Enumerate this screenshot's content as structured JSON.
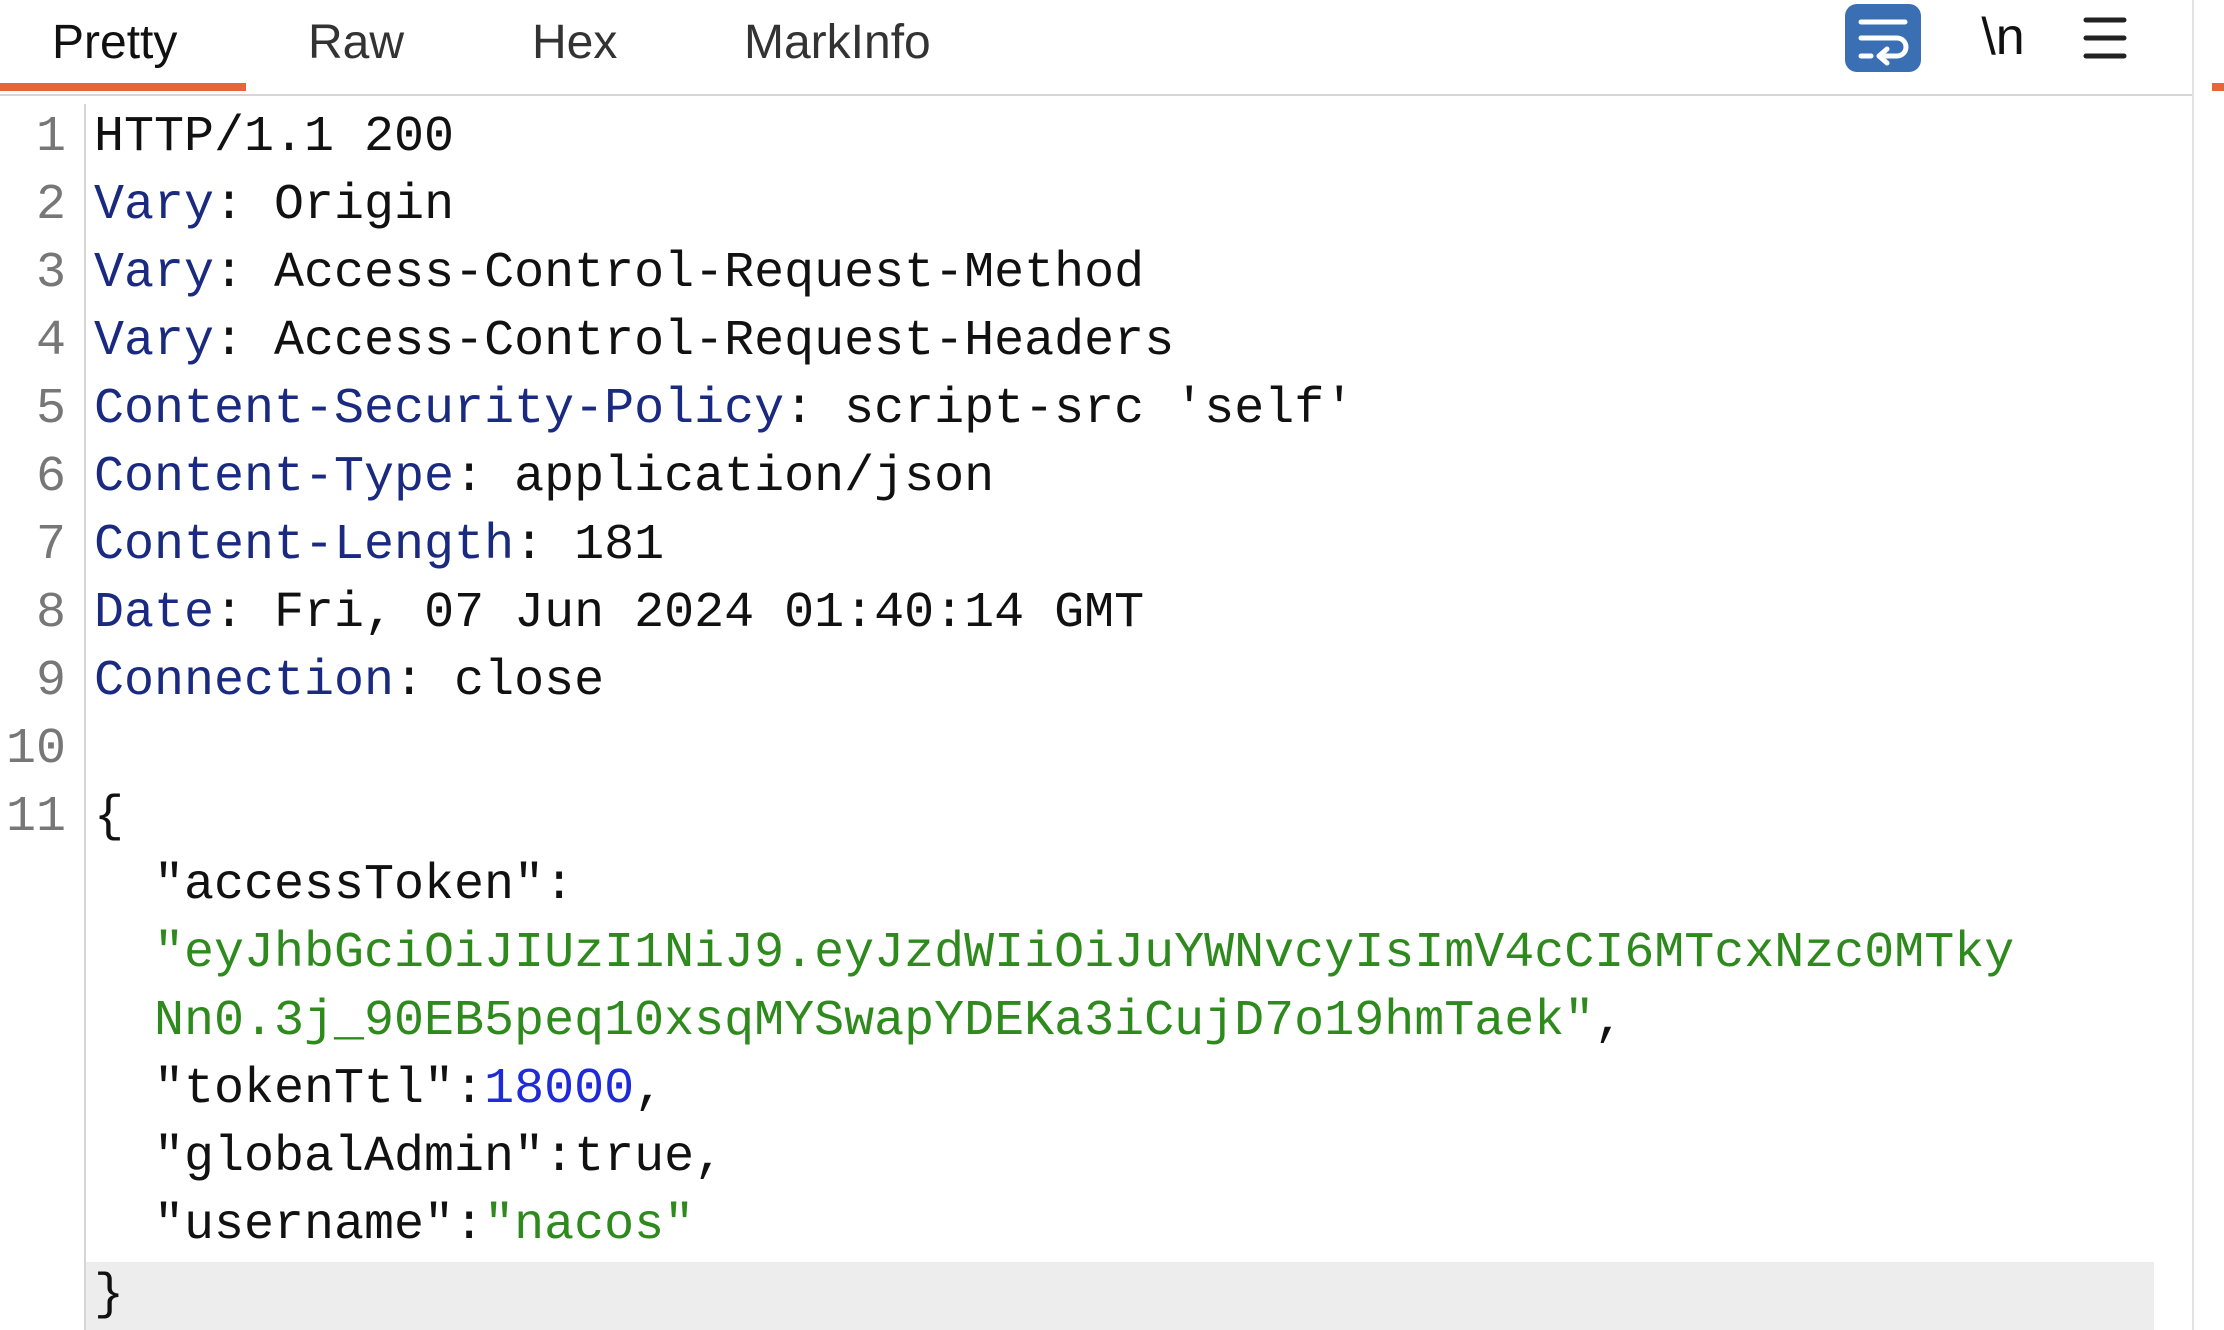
{
  "tabs": [
    {
      "label": "Pretty",
      "active": true
    },
    {
      "label": "Raw",
      "active": false
    },
    {
      "label": "Hex",
      "active": false
    },
    {
      "label": "MarkInfo",
      "active": false
    }
  ],
  "toolbar": {
    "wrap_icon": "word-wrap-icon",
    "newline_label": "\\n",
    "menu_icon": "hamburger-menu-icon"
  },
  "colors": {
    "accent": "#e8653a",
    "wrap_button": "#3a6fb4",
    "header_name": "#1a2a80",
    "string": "#2f8a1e",
    "number": "#1f2ad8"
  },
  "line_numbers": [
    "1",
    "2",
    "3",
    "4",
    "5",
    "6",
    "7",
    "8",
    "9",
    "10",
    "11"
  ],
  "response": {
    "status_line": "HTTP/1.1 200",
    "separator": ": ",
    "headers": [
      {
        "name": "Vary",
        "value": "Origin"
      },
      {
        "name": "Vary",
        "value": "Access-Control-Request-Method"
      },
      {
        "name": "Vary",
        "value": "Access-Control-Request-Headers"
      },
      {
        "name": "Content-Security-Policy",
        "value": "script-src 'self'"
      },
      {
        "name": "Content-Type",
        "value": "application/json"
      },
      {
        "name": "Content-Length",
        "value": "181"
      },
      {
        "name": "Date",
        "value": "Fri, 07 Jun 2024 01:40:14 GMT"
      },
      {
        "name": "Connection",
        "value": "close"
      }
    ],
    "body": {
      "open_brace": "{",
      "close_brace": "}",
      "colon": ":",
      "comma": ",",
      "access_token_key": "\"accessToken\"",
      "access_token_value_part1": "\"eyJhbGciOiJIUzI1NiJ9.eyJzdWIiOiJuYWNvcyIsImV4cCI6MTcxNzc0MTky",
      "access_token_value_part2": "Nn0.3j_90EB5peq10xsqMYSwapYDEKa3iCujD7o19hmTaek\"",
      "token_ttl_key": "\"tokenTtl\"",
      "token_ttl_value": "18000",
      "global_admin_key": "\"globalAdmin\"",
      "global_admin_value": "true",
      "username_key": "\"username\"",
      "username_value": "\"nacos\""
    }
  }
}
